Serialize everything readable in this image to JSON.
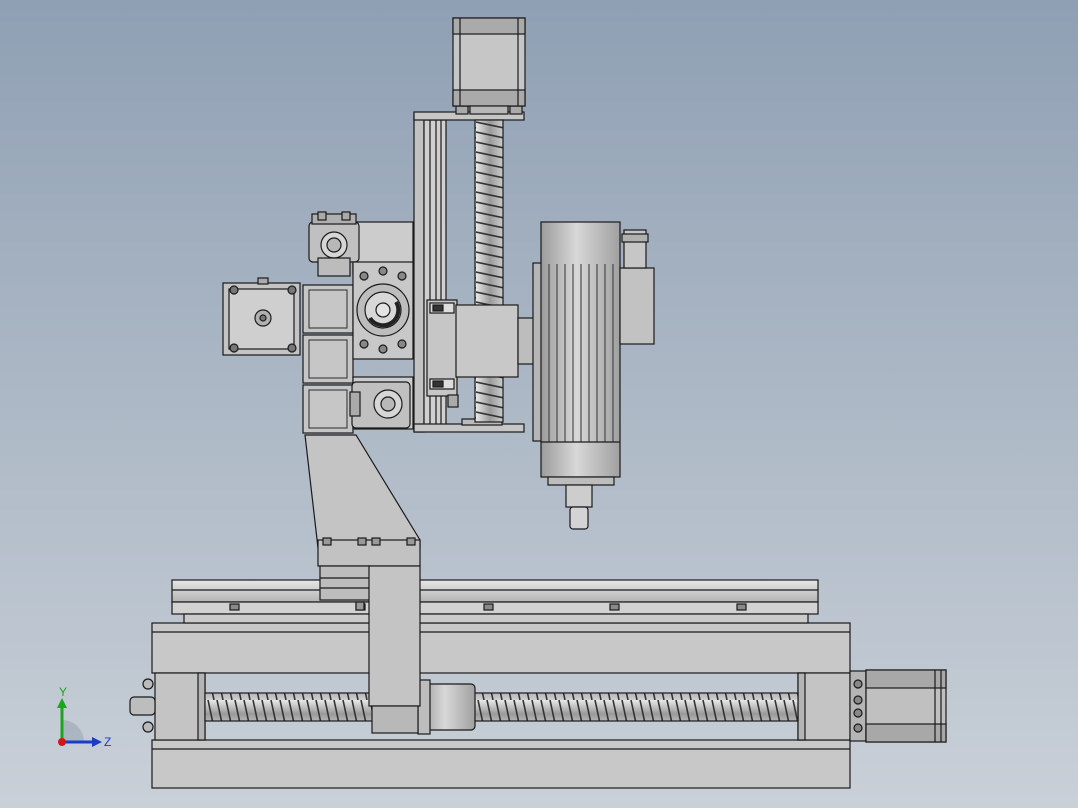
{
  "viewport": {
    "background_top": "#8fa0b4",
    "background_bottom": "#c9d0d8",
    "part_fill": "#c8c8c8",
    "part_dark": "#9a9a9a",
    "edge_color": "#1a1a1a"
  },
  "triad": {
    "y_label": "Y",
    "z_label": "Z",
    "y_color": "#1aa81a",
    "z_color": "#1a3cc8",
    "x_color": "#d01818"
  }
}
